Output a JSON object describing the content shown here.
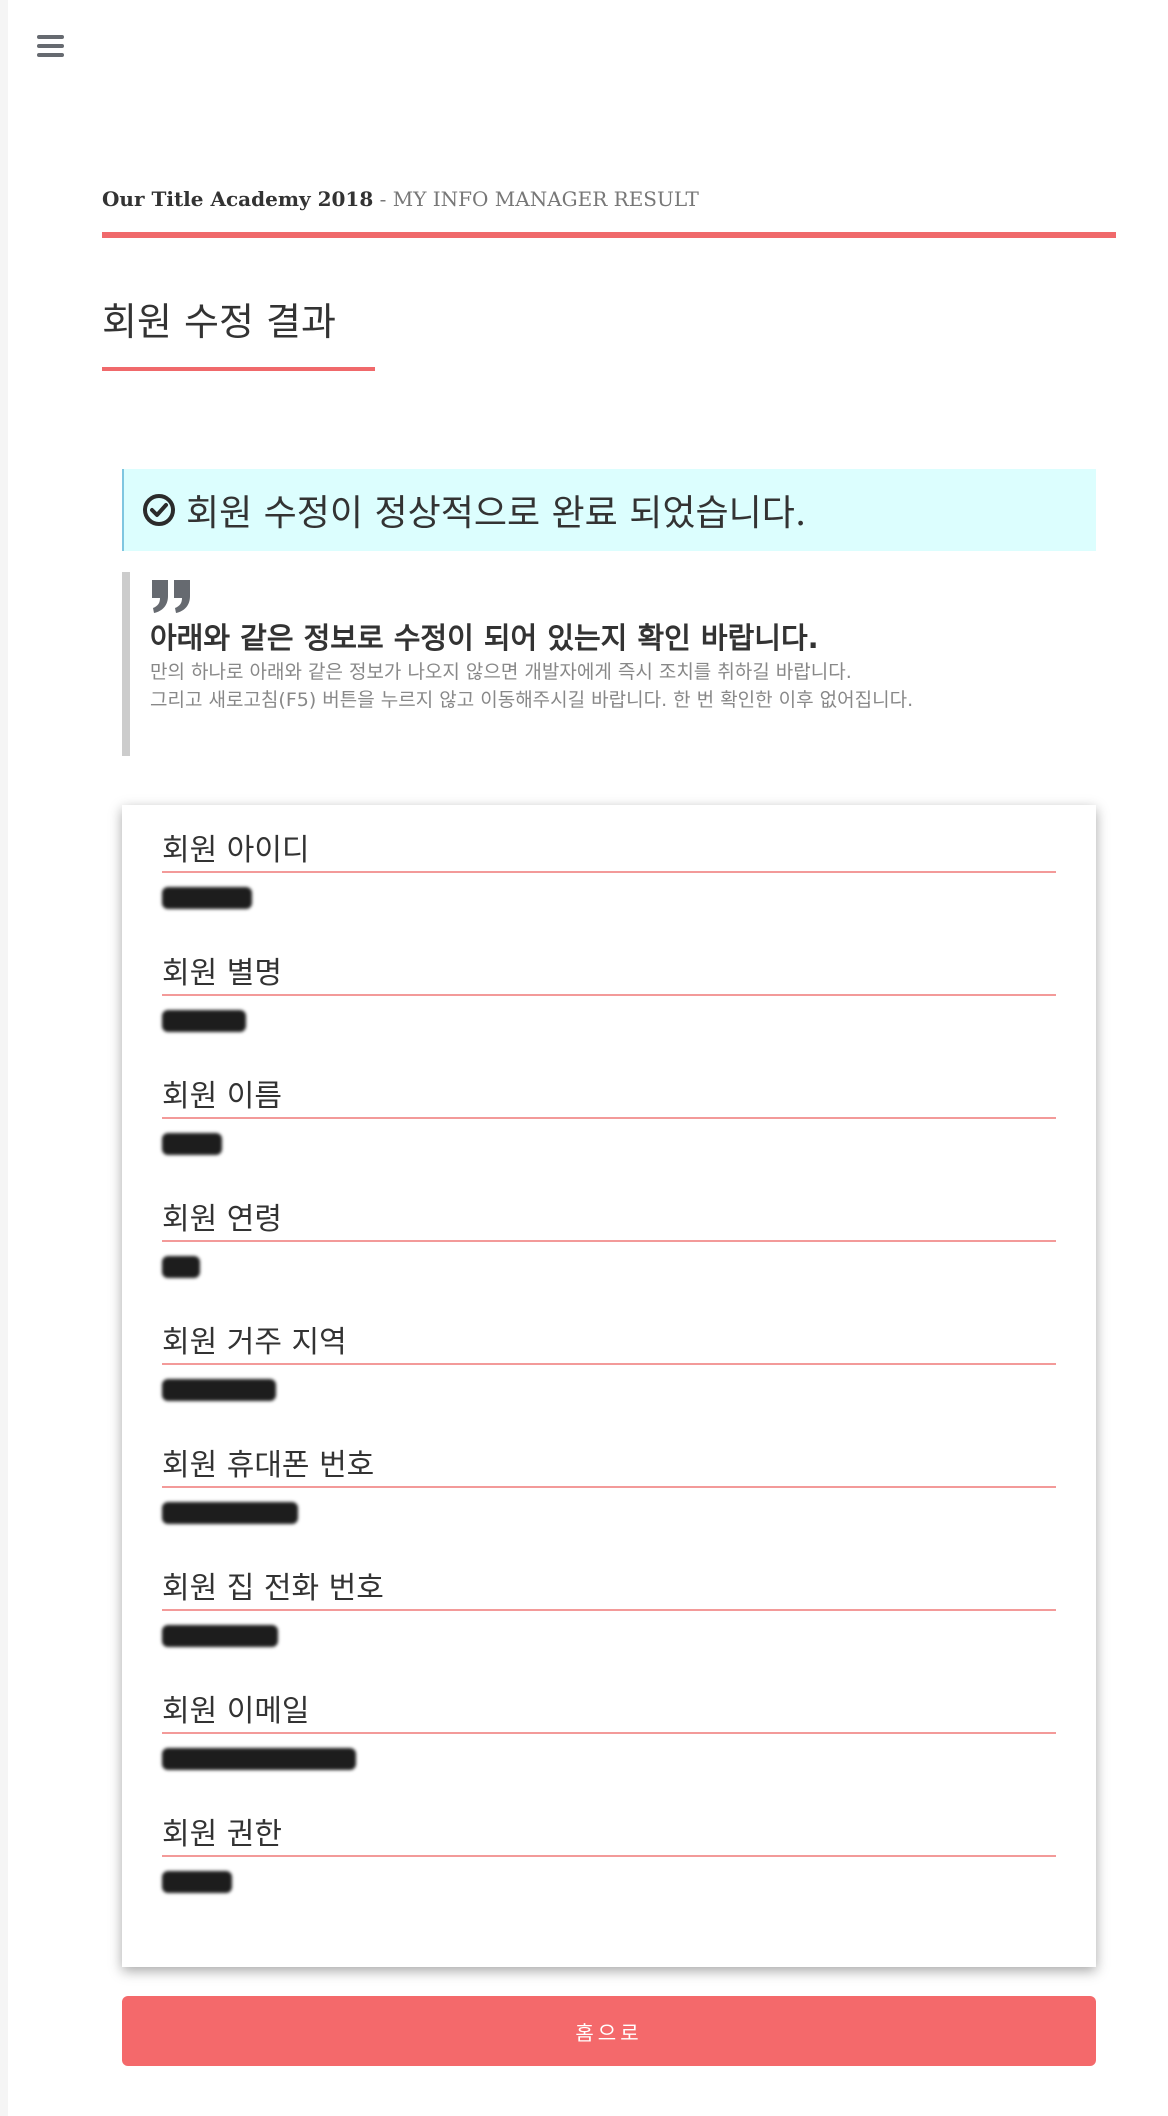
{
  "nav": {
    "menu_icon": "hamburger-icon"
  },
  "header": {
    "brand": "Our Title Academy 2018",
    "subtitle": " - MY INFO MANAGER RESULT"
  },
  "page": {
    "title": "회원 수정 결과"
  },
  "alert": {
    "icon": "check-circle-icon",
    "message": "회원 수정이 정상적으로 완료 되었습니다."
  },
  "notice": {
    "icon": "quote-icon",
    "heading": "아래와 같은 정보로 수정이 되어 있는지 확인 바랍니다.",
    "line1": "만의 하나로 아래와 같은 정보가 나오지 않으면 개발자에게 즉시 조치를 취하길 바랍니다.",
    "line2": "그리고 새로고침(F5) 버튼을 누르지 않고 이동해주시길 바랍니다. 한 번 확인한 이후 없어집니다."
  },
  "fields": [
    {
      "label": "회원 아이디"
    },
    {
      "label": "회원 별명"
    },
    {
      "label": "회원 이름"
    },
    {
      "label": "회원 연령"
    },
    {
      "label": "회원 거주 지역"
    },
    {
      "label": "회원 휴대폰 번호"
    },
    {
      "label": "회원 집 전화 번호"
    },
    {
      "label": "회원 이메일"
    },
    {
      "label": "회원 권한"
    }
  ],
  "home_button": {
    "label": "홈으로"
  },
  "colors": {
    "accent": "#f0696b",
    "alert_bg": "#dcfefe",
    "field_rule": "#f39a99"
  }
}
